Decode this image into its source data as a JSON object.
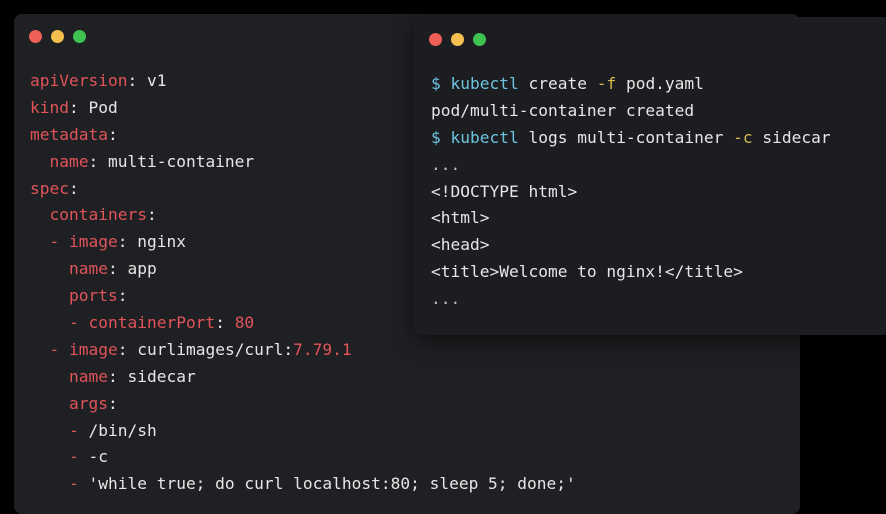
{
  "colors": {
    "close": "#ed5f57",
    "minimize": "#f4bf4f",
    "maximize": "#3fc250",
    "yaml_key": "#e0545a",
    "prompt": "#6cc4e0",
    "flag": "#d6b94a",
    "text": "#e6e6e6"
  },
  "editor": {
    "lines": [
      [
        {
          "t": "apiVersion",
          "c": "key"
        },
        {
          "t": ": ",
          "c": "val"
        },
        {
          "t": "v1",
          "c": "val"
        }
      ],
      [
        {
          "t": "kind",
          "c": "key"
        },
        {
          "t": ": ",
          "c": "val"
        },
        {
          "t": "Pod",
          "c": "val"
        }
      ],
      [
        {
          "t": "metadata",
          "c": "key"
        },
        {
          "t": ":",
          "c": "val"
        }
      ],
      [
        {
          "t": "  ",
          "c": "val"
        },
        {
          "t": "name",
          "c": "key"
        },
        {
          "t": ": ",
          "c": "val"
        },
        {
          "t": "multi-container",
          "c": "val"
        }
      ],
      [
        {
          "t": "spec",
          "c": "key"
        },
        {
          "t": ":",
          "c": "val"
        }
      ],
      [
        {
          "t": "  ",
          "c": "val"
        },
        {
          "t": "containers",
          "c": "key"
        },
        {
          "t": ":",
          "c": "val"
        }
      ],
      [
        {
          "t": "  ",
          "c": "val"
        },
        {
          "t": "- ",
          "c": "dash"
        },
        {
          "t": "image",
          "c": "key"
        },
        {
          "t": ": ",
          "c": "val"
        },
        {
          "t": "nginx",
          "c": "val"
        }
      ],
      [
        {
          "t": "    ",
          "c": "val"
        },
        {
          "t": "name",
          "c": "key"
        },
        {
          "t": ": ",
          "c": "val"
        },
        {
          "t": "app",
          "c": "val"
        }
      ],
      [
        {
          "t": "    ",
          "c": "val"
        },
        {
          "t": "ports",
          "c": "key"
        },
        {
          "t": ":",
          "c": "val"
        }
      ],
      [
        {
          "t": "    ",
          "c": "val"
        },
        {
          "t": "- ",
          "c": "dash"
        },
        {
          "t": "containerPort",
          "c": "key"
        },
        {
          "t": ": ",
          "c": "val"
        },
        {
          "t": "80",
          "c": "num"
        }
      ],
      [
        {
          "t": "  ",
          "c": "val"
        },
        {
          "t": "- ",
          "c": "dash"
        },
        {
          "t": "image",
          "c": "key"
        },
        {
          "t": ": ",
          "c": "val"
        },
        {
          "t": "curlimages/curl:",
          "c": "val"
        },
        {
          "t": "7.79.1",
          "c": "num"
        }
      ],
      [
        {
          "t": "    ",
          "c": "val"
        },
        {
          "t": "name",
          "c": "key"
        },
        {
          "t": ": ",
          "c": "val"
        },
        {
          "t": "sidecar",
          "c": "val"
        }
      ],
      [
        {
          "t": "    ",
          "c": "val"
        },
        {
          "t": "args",
          "c": "key"
        },
        {
          "t": ":",
          "c": "val"
        }
      ],
      [
        {
          "t": "    ",
          "c": "val"
        },
        {
          "t": "- ",
          "c": "dash"
        },
        {
          "t": "/bin/sh",
          "c": "val"
        }
      ],
      [
        {
          "t": "    ",
          "c": "val"
        },
        {
          "t": "- ",
          "c": "dash"
        },
        {
          "t": "-c",
          "c": "val"
        }
      ],
      [
        {
          "t": "    ",
          "c": "val"
        },
        {
          "t": "- ",
          "c": "dash"
        },
        {
          "t": "'while true; do curl localhost:80; sleep 5; done;'",
          "c": "val"
        }
      ]
    ]
  },
  "terminal": {
    "lines": [
      [
        {
          "t": "$ ",
          "c": "prompt"
        },
        {
          "t": "kubectl",
          "c": "cmd"
        },
        {
          "t": " create ",
          "c": "out"
        },
        {
          "t": "-f",
          "c": "flag"
        },
        {
          "t": " pod.yaml",
          "c": "out"
        }
      ],
      [
        {
          "t": "pod/multi-container created",
          "c": "out"
        }
      ],
      [
        {
          "t": "$ ",
          "c": "prompt"
        },
        {
          "t": "kubectl",
          "c": "cmd"
        },
        {
          "t": " logs multi-container ",
          "c": "out"
        },
        {
          "t": "-c",
          "c": "flag"
        },
        {
          "t": " sidecar",
          "c": "out"
        }
      ],
      [
        {
          "t": "...",
          "c": "dim"
        }
      ],
      [
        {
          "t": "<!DOCTYPE html>",
          "c": "out"
        }
      ],
      [
        {
          "t": "<html>",
          "c": "out"
        }
      ],
      [
        {
          "t": "<head>",
          "c": "out"
        }
      ],
      [
        {
          "t": "<title>Welcome to nginx!</title>",
          "c": "out"
        }
      ],
      [
        {
          "t": "...",
          "c": "dim"
        }
      ]
    ]
  }
}
